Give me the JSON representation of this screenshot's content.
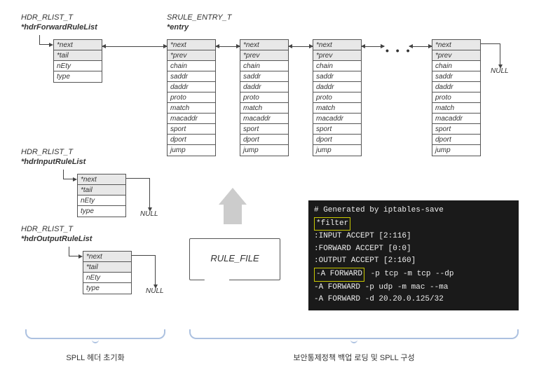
{
  "structs": {
    "forward": {
      "type": "HDR_RLIST_T",
      "name": "*hdrForwardRuleList"
    },
    "input": {
      "type": "HDR_RLIST_T",
      "name": "*hdrInputRuleList"
    },
    "output": {
      "type": "HDR_RLIST_T",
      "name": "*hdrOutputRuleList"
    },
    "entry": {
      "type": "SRULE_ENTRY_T",
      "name": "*entry"
    }
  },
  "head_rows": {
    "next": "*next",
    "tail": "*tail",
    "nEty": "nEty",
    "type": "type"
  },
  "entry_rows": {
    "next": "*next",
    "prev": "*prev",
    "chain": "chain",
    "saddr": "saddr",
    "daddr": "daddr",
    "proto": "proto",
    "match": "match",
    "macaddr": "macaddr",
    "sport": "sport",
    "dport": "dport",
    "jump": "jump"
  },
  "null_label": "NULL",
  "dots": "• • •",
  "rule_file_label": "RULE_FILE",
  "terminal": {
    "l0": "# Generated by iptables-save",
    "l1": "*filter",
    "l2": ":INPUT ACCEPT [2:116]",
    "l3": ":FORWARD ACCEPT [0:0]",
    "l4": ":OUTPUT ACCEPT [2:160]",
    "l5a": "-A FORWARD",
    "l5b": " -p tcp -m tcp --dp",
    "l6": "-A FORWARD -p udp -m mac --ma",
    "l7": "-A FORWARD -d 20.20.0.125/32"
  },
  "braces": {
    "left": "SPLL  헤더 초기화",
    "right": "보안통제정책 백업 로딩 및 SPLL 구성"
  }
}
